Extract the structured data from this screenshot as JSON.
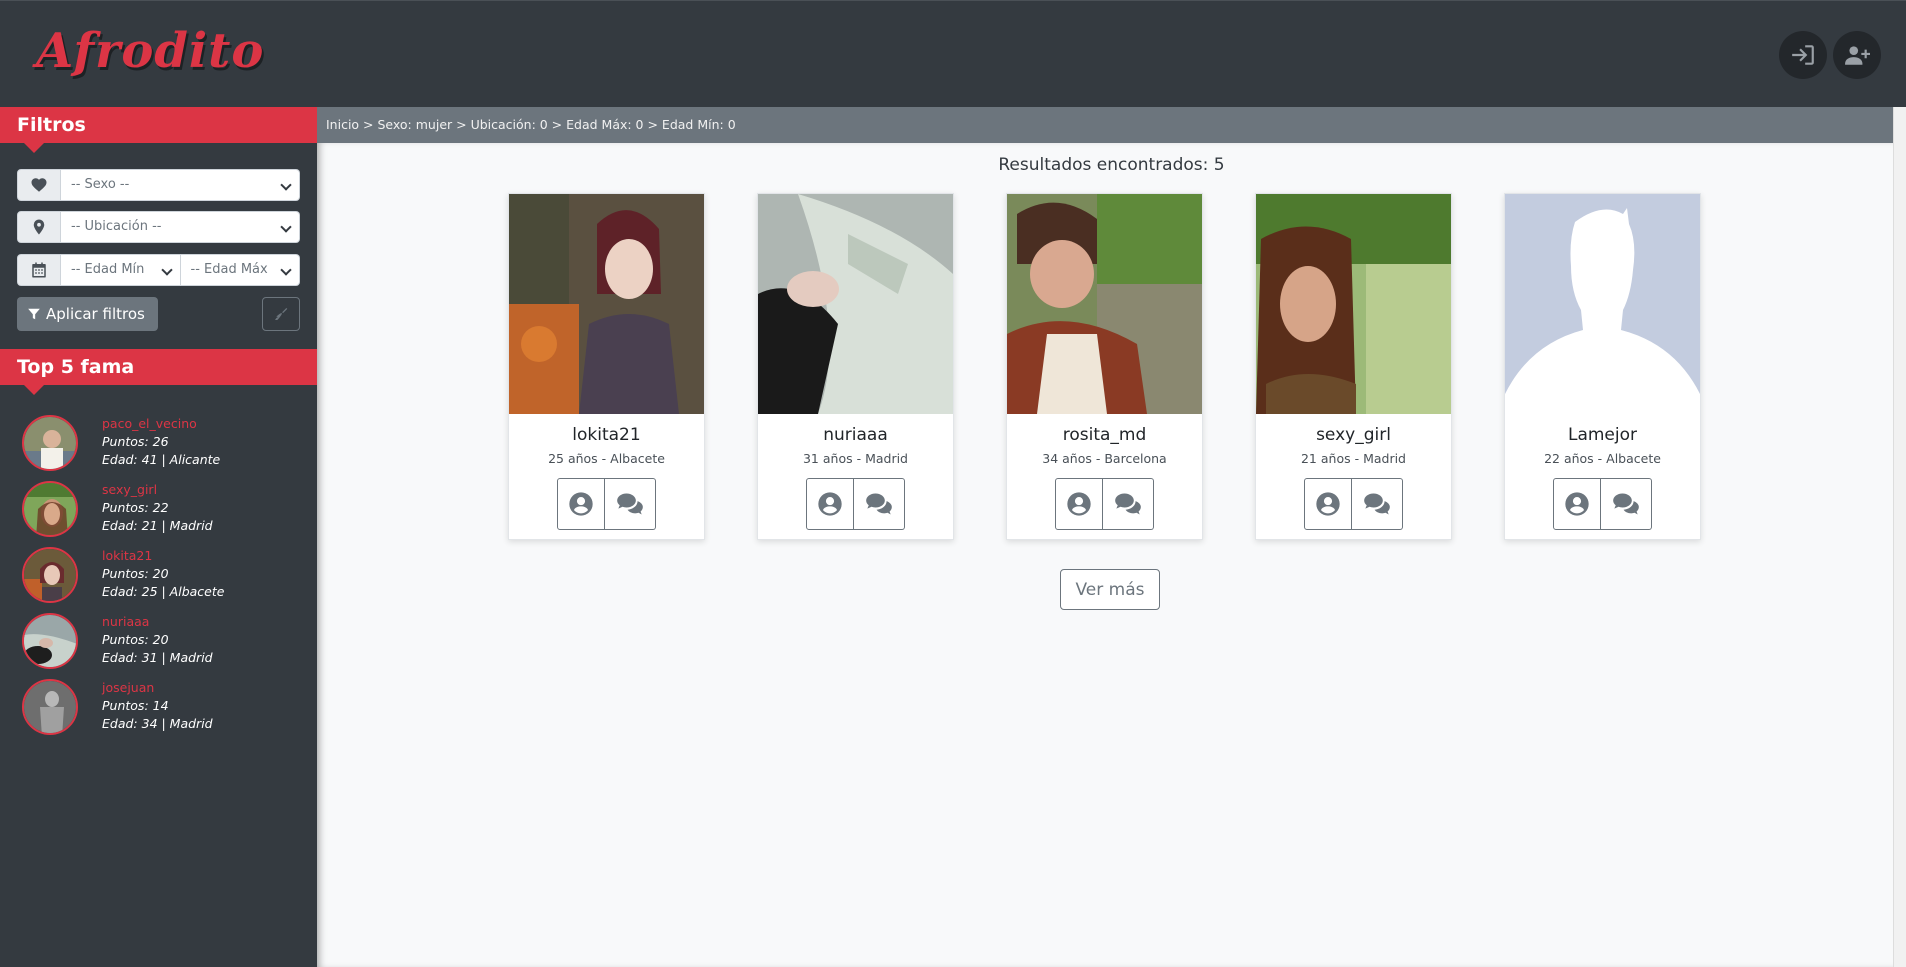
{
  "header": {
    "logo": "Afrodito",
    "login_icon": "sign-in-icon",
    "register_icon": "user-plus-icon"
  },
  "sidebar": {
    "filters_title": "Filtros",
    "sexo_placeholder": "-- Sexo --",
    "ubicacion_placeholder": "-- Ubicación --",
    "edad_min_placeholder": "-- Edad Mín",
    "edad_max_placeholder": "-- Edad Máx",
    "apply_label": "Aplicar filtros",
    "top_title": "Top 5 fama",
    "top": [
      {
        "name": "paco_el_vecino",
        "points": "Puntos: 26",
        "info": "Edad: 41 | Alicante"
      },
      {
        "name": "sexy_girl",
        "points": "Puntos: 22",
        "info": "Edad: 21 | Madrid"
      },
      {
        "name": "lokita21",
        "points": "Puntos: 20",
        "info": "Edad: 25 | Albacete"
      },
      {
        "name": "nuriaaa",
        "points": "Puntos: 20",
        "info": "Edad: 31 | Madrid"
      },
      {
        "name": "josejuan",
        "points": "Puntos: 14",
        "info": "Edad: 34 | Madrid"
      }
    ]
  },
  "breadcrumb": "Inicio > Sexo: mujer > Ubicación: 0 > Edad Máx: 0 > Edad Mín: 0",
  "results_label": "Resultados encontrados: 5",
  "cards": [
    {
      "name": "lokita21",
      "meta": "25 años - Albacete"
    },
    {
      "name": "nuriaaa",
      "meta": "31 años - Madrid"
    },
    {
      "name": "rosita_md",
      "meta": "34 años - Barcelona"
    },
    {
      "name": "sexy_girl",
      "meta": "21 años - Madrid"
    },
    {
      "name": "Lamejor",
      "meta": "22 años - Albacete"
    }
  ],
  "more_label": "Ver más",
  "colors": {
    "accent": "#dc3545",
    "dark": "#343a40",
    "secondary": "#6c757d"
  }
}
